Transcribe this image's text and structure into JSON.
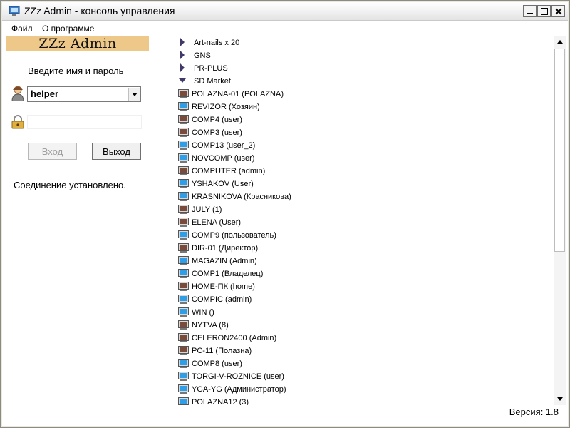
{
  "window": {
    "title": "ZZz Admin - консоль управления",
    "minimize_icon": "minimize-icon",
    "maximize_icon": "maximize-icon",
    "close_icon": "close-icon"
  },
  "menu": {
    "items": [
      "Файл",
      "О программе"
    ]
  },
  "login": {
    "logo": "ZZz Admin",
    "prompt": "Введите имя и пароль",
    "username": "helper",
    "password": "",
    "login_button": "Вход",
    "exit_button": "Выход",
    "status": "Соединение установлено."
  },
  "tree": {
    "groups": [
      {
        "label": "Art-nails x 20",
        "state": "collapsed"
      },
      {
        "label": "GNS",
        "state": "collapsed"
      },
      {
        "label": "PR-PLUS",
        "state": "collapsed"
      },
      {
        "label": "SD Market",
        "state": "expanded"
      }
    ],
    "computers": [
      {
        "label": "POLAZNA-01 (POLAZNA)",
        "status": "offline"
      },
      {
        "label": "REVIZOR (Хозяин)",
        "status": "online"
      },
      {
        "label": "COMP4 (user)",
        "status": "offline"
      },
      {
        "label": "COMP3 (user)",
        "status": "offline"
      },
      {
        "label": "COMP13 (user_2)",
        "status": "online"
      },
      {
        "label": "NOVCOMP (user)",
        "status": "online"
      },
      {
        "label": "COMPUTER (admin)",
        "status": "offline"
      },
      {
        "label": "YSHAKOV (User)",
        "status": "online"
      },
      {
        "label": "KRASNIKOVA (Красникова)",
        "status": "online"
      },
      {
        "label": "JULY (1)",
        "status": "offline"
      },
      {
        "label": "ELENA (User)",
        "status": "offline"
      },
      {
        "label": "COMP9 (пользователь)",
        "status": "online"
      },
      {
        "label": "DIR-01 (Директор)",
        "status": "offline"
      },
      {
        "label": "MAGAZIN (Admin)",
        "status": "online"
      },
      {
        "label": "COMP1 (Владелец)",
        "status": "online"
      },
      {
        "label": "HOME-ПК (home)",
        "status": "offline"
      },
      {
        "label": "COMPIC (admin)",
        "status": "online"
      },
      {
        "label": "WIN ()",
        "status": "online"
      },
      {
        "label": "NYTVA (8)",
        "status": "offline"
      },
      {
        "label": "CELERON2400 (Admin)",
        "status": "offline"
      },
      {
        "label": "PC-11 (Полазна)",
        "status": "offline"
      },
      {
        "label": "COMP8 (user)",
        "status": "online"
      },
      {
        "label": "TORGI-V-ROZNICE (user)",
        "status": "online"
      },
      {
        "label": "YGA-YG (Администратор)",
        "status": "online"
      },
      {
        "label": "POLAZNA12 (3)",
        "status": "online"
      }
    ]
  },
  "footer": {
    "version": "Версия: 1.8"
  },
  "colors": {
    "online_monitor": "#2f9ee8",
    "offline_monitor": "#7a4a3a",
    "logo_background": "#eec888"
  }
}
